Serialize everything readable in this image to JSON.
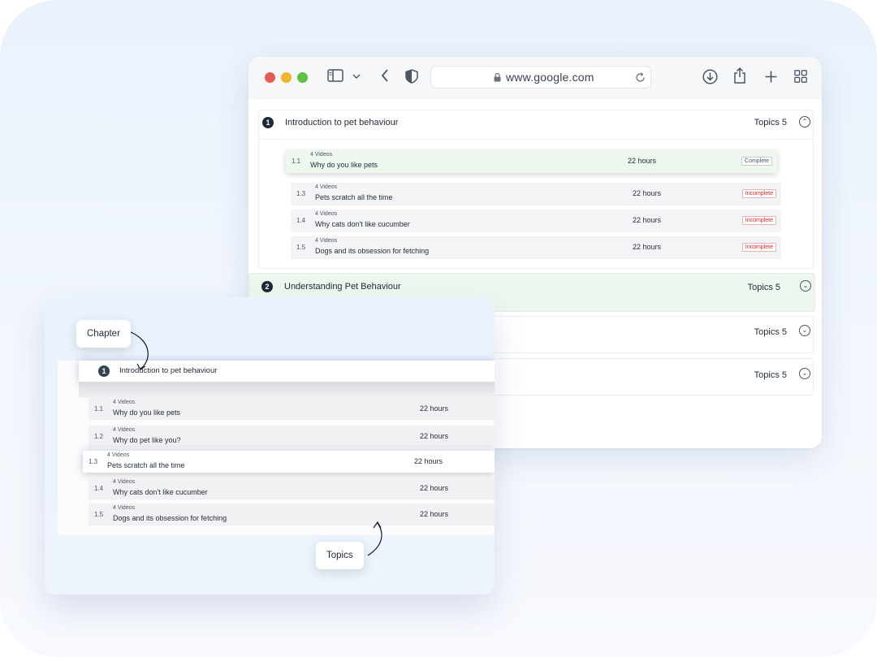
{
  "browser": {
    "url": "www.google.com",
    "traffic_lights": {
      "close": "#e25d56",
      "minimize": "#f0b52d",
      "maximize": "#5dc23f"
    }
  },
  "chapters": [
    {
      "num": "1",
      "title": "Introduction to pet behaviour",
      "topics": "Topics 5",
      "expanded": true,
      "items": [
        {
          "idx": "1.1",
          "videos": "4 Videos",
          "title": "Why do you like pets",
          "hours": "22 hours",
          "status": "Complete",
          "highlighted": true
        },
        {
          "idx": "1.3",
          "videos": "4 Videos",
          "title": "Pets scratch all the time",
          "hours": "22 hours",
          "status": "Incomplete"
        },
        {
          "idx": "1.4",
          "videos": "4 Videos",
          "title": "Why cats don't like cucumber",
          "hours": "22 hours",
          "status": "Incomplete"
        },
        {
          "idx": "1.5",
          "videos": "4 Videos",
          "title": "Dogs and its obsession for fetching",
          "hours": "22 hours",
          "status": "Incomplete"
        }
      ]
    },
    {
      "num": "2",
      "title": "Understanding Pet Behaviour",
      "topics": "Topics 5",
      "expanded": false
    },
    {
      "topics": "Topics 5",
      "expanded": false
    },
    {
      "topics": "Topics 5",
      "expanded": false
    }
  ],
  "callout": {
    "chapter_label": "Chapter",
    "topics_label": "Topics",
    "chapter": {
      "num": "1",
      "title": "Introduction to pet behaviour"
    },
    "items": [
      {
        "idx": "1.1",
        "videos": "4 Videos",
        "title": "Why do you like pets",
        "hours": "22 hours"
      },
      {
        "idx": "1.2",
        "videos": "4 Videos",
        "title": "Why do pet like you?",
        "hours": "22 hours"
      },
      {
        "idx": "1.3",
        "videos": "4 Videos",
        "title": "Pets scratch all the time",
        "hours": "22 hours",
        "highlighted": true
      },
      {
        "idx": "1.4",
        "videos": "4 Videos",
        "title": "Why cats don't like cucumber",
        "hours": "22 hours"
      },
      {
        "idx": "1.5",
        "videos": "4 Videos",
        "title": "Dogs and its obsession for fetching",
        "hours": "22 hours"
      }
    ]
  }
}
